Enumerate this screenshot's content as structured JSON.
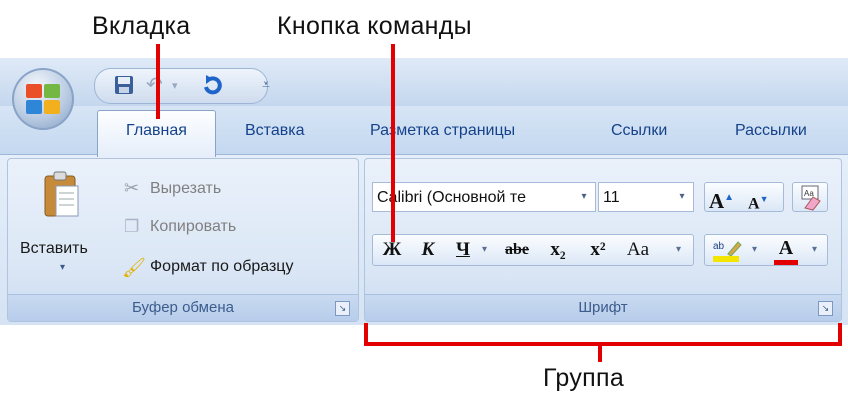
{
  "annotations": {
    "tab_label": "Вкладка",
    "command_button_label": "Кнопка команды",
    "group_label": "Группа",
    "line_color": "#e30000"
  },
  "quick_access": {
    "icons": [
      "save-icon",
      "undo-icon",
      "redo-icon",
      "customize-arrow-icon"
    ]
  },
  "tabs": [
    {
      "label": "Главная",
      "active": true
    },
    {
      "label": "Вставка",
      "active": false
    },
    {
      "label": "Разметка страницы",
      "active": false
    },
    {
      "label": "Ссылки",
      "active": false
    },
    {
      "label": "Рассылки",
      "active": false
    }
  ],
  "clipboard_group": {
    "title": "Буфер обмена",
    "paste_label": "Вставить",
    "cut_label": "Вырезать",
    "copy_label": "Копировать",
    "format_painter_label": "Формат по образцу"
  },
  "font_group": {
    "title": "Шрифт",
    "font_name": "Calibri (Основной те",
    "font_size": "11",
    "bold": "Ж",
    "italic": "К",
    "underline": "Ч",
    "strikethrough": "abe",
    "subscript": "x₂",
    "superscript": "x²",
    "change_case": "Aa",
    "grow_font": "A",
    "shrink_font": "A",
    "font_color": "A",
    "font_color_bar": "#e30000",
    "highlight_bar": "#f4e500"
  }
}
